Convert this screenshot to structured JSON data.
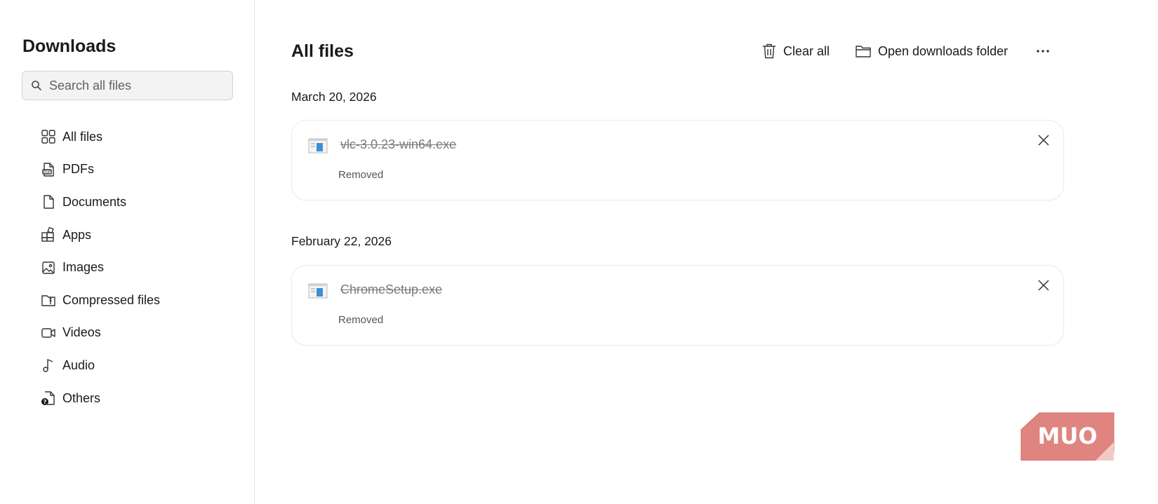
{
  "sidebar": {
    "title": "Downloads",
    "search": {
      "placeholder": "Search all files",
      "value": ""
    },
    "items": [
      {
        "label": "All files",
        "icon": "grid-icon"
      },
      {
        "label": "PDFs",
        "icon": "pdf-icon"
      },
      {
        "label": "Documents",
        "icon": "document-icon"
      },
      {
        "label": "Apps",
        "icon": "apps-icon"
      },
      {
        "label": "Images",
        "icon": "image-icon"
      },
      {
        "label": "Compressed files",
        "icon": "zip-icon"
      },
      {
        "label": "Videos",
        "icon": "video-icon"
      },
      {
        "label": "Audio",
        "icon": "audio-icon"
      },
      {
        "label": "Others",
        "icon": "unknown-file-icon"
      }
    ]
  },
  "main": {
    "title": "All files",
    "toolbar": {
      "clear_all": "Clear all",
      "open_folder": "Open downloads folder",
      "more": "more-icon"
    },
    "groups": [
      {
        "date": "March 20, 2026",
        "files": [
          {
            "name": "vlc-3.0.23-win64.exe",
            "status": "Removed"
          }
        ]
      },
      {
        "date": "February 22, 2026",
        "files": [
          {
            "name": "ChromeSetup.exe",
            "status": "Removed"
          }
        ]
      }
    ]
  },
  "watermark": {
    "text": "MUO",
    "color": "#e0847f"
  },
  "colors": {
    "accent": "#1a1a1a",
    "file_icon_blue": "#3b8fd9",
    "watermark": "#e0847f"
  }
}
